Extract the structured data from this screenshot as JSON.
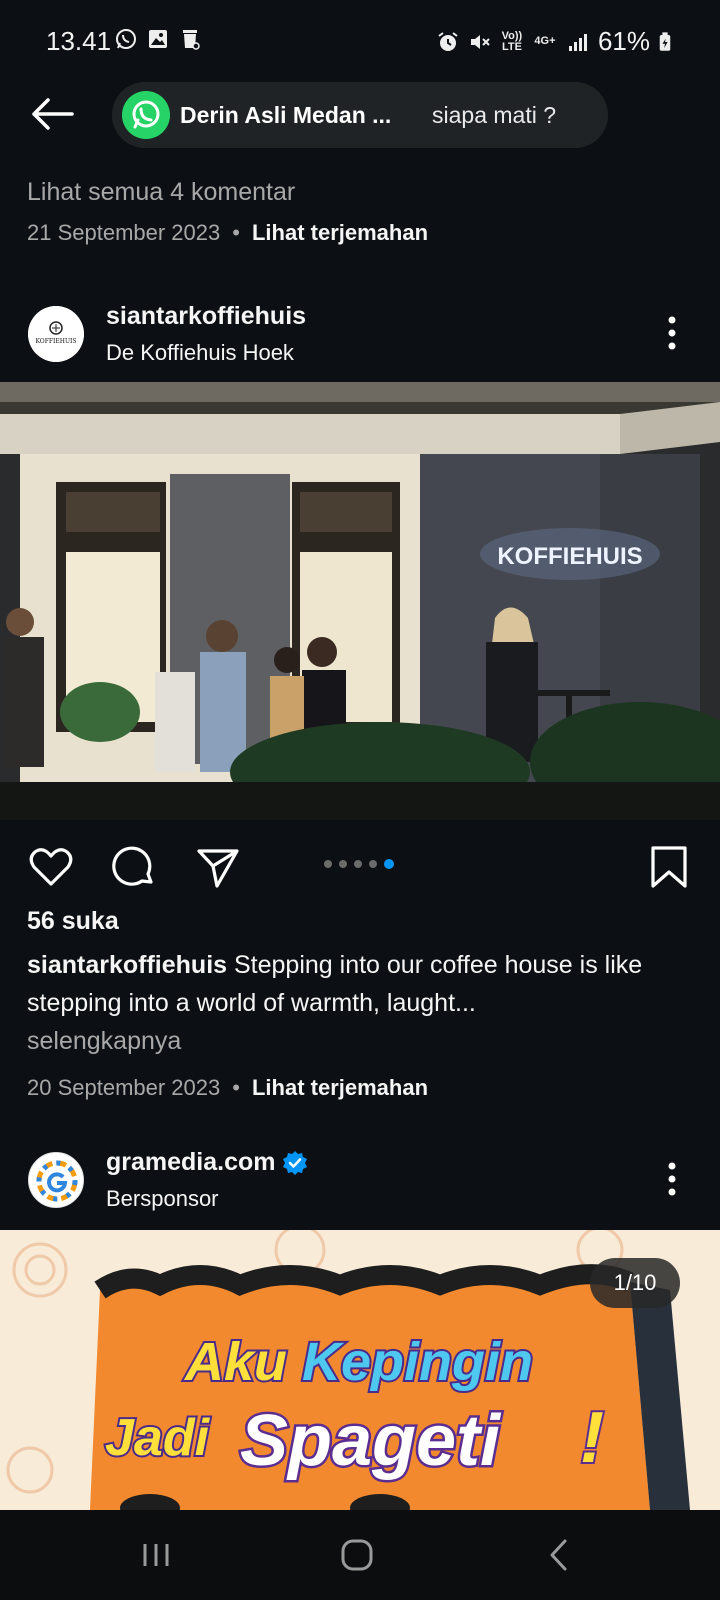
{
  "status_bar": {
    "time": "13.41",
    "left_icons": [
      "whatsapp-icon",
      "gallery-icon",
      "trash-icon"
    ],
    "right_icons": [
      "alarm-icon",
      "mute-icon",
      "volte-icon",
      "4g-icon",
      "signal-icon",
      "battery-icon"
    ],
    "volte_label": "Vo)) LTE",
    "network_label": "4G+",
    "battery": "61%"
  },
  "notification": {
    "app_icon": "whatsapp-icon",
    "title": "Derin Asli Medan ...",
    "message": "siapa mati ?"
  },
  "previous_post": {
    "comments_link": "Lihat semua 4 komentar",
    "date": "21 September 2023",
    "translate": "Lihat terjemahan"
  },
  "post": {
    "username": "siantarkoffiehuis",
    "subtitle": "De Koffiehuis Hoek",
    "avatar_text": "KOFFIEHUIS",
    "sign_text": "KOFFIEHUIS",
    "carousel": {
      "count": 5,
      "active_index": 5
    },
    "likes": "56 suka",
    "caption_user": "siantarkoffiehuis",
    "caption_text": " Stepping into our coffee house is like stepping into a world of warmth, laught...",
    "more": "selengkapnya",
    "date": "20 September 2023",
    "translate": "Lihat terjemahan"
  },
  "sponsored_post": {
    "username": "gramedia.com",
    "subtitle": "Bersponsor",
    "verified": true,
    "counter": "1/10",
    "ad_line1_a": "Aku",
    "ad_line1_b": "Kepingin",
    "ad_line2_a": "Jadi",
    "ad_line2_b": "Spageti",
    "ad_exclaim": "!"
  },
  "colors": {
    "background": "#0c1014",
    "accent_blue": "#0095f6",
    "whatsapp_green": "#25d366",
    "ad_background": "#f8ebd8",
    "ad_orange": "#f2892e"
  }
}
